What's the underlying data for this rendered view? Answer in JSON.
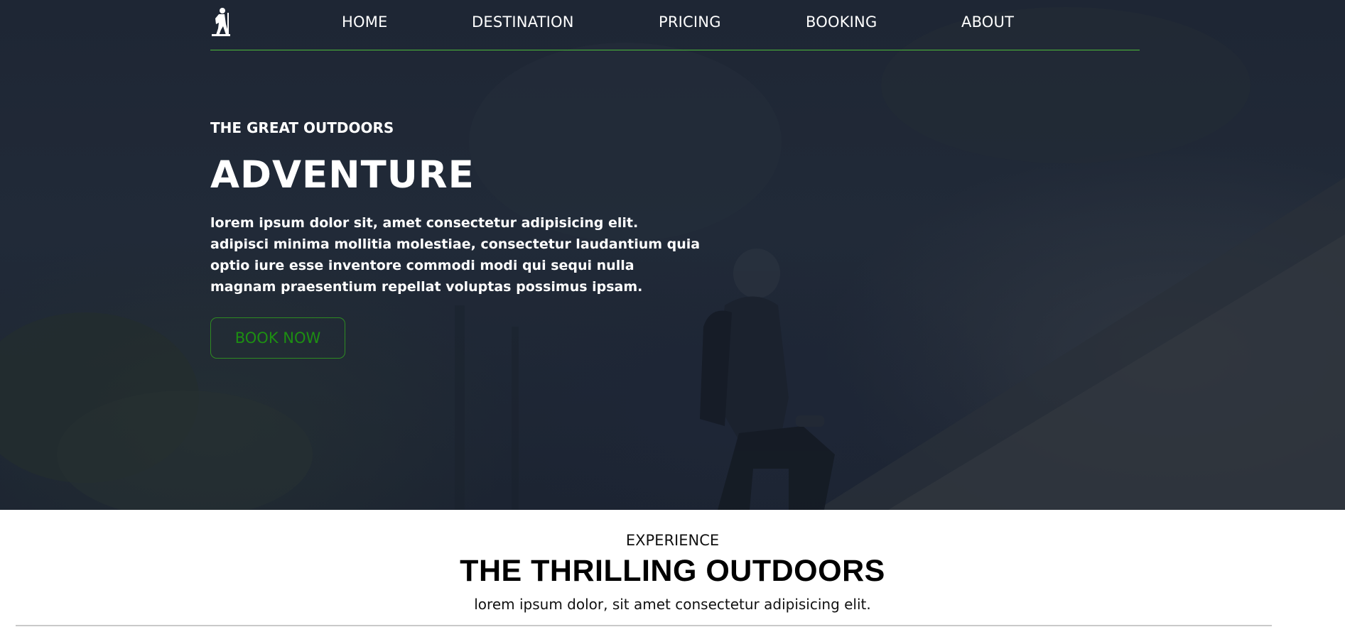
{
  "colors": {
    "accent": "#4cbb3a",
    "button_text": "#1d8f12",
    "hero_overlay": "#1e2634"
  },
  "nav": {
    "logo_icon": "hiker-logo-icon",
    "links": [
      {
        "label": "HOME"
      },
      {
        "label": "DESTINATION"
      },
      {
        "label": "PRICING"
      },
      {
        "label": "BOOKING"
      },
      {
        "label": "ABOUT"
      }
    ]
  },
  "hero": {
    "eyebrow": "THE GREAT OUTDOORS",
    "title": "ADVENTURE",
    "text": "lorem ipsum dolor sit, amet consectetur adipisicing elit. adipisci minima mollitia molestiae, consectetur laudantium quia optio iure esse inventore commodi modi qui sequi nulla magnam praesentium repellat voluptas possimus ipsam.",
    "button_label": "BOOK NOW"
  },
  "experience": {
    "eyebrow": "EXPERIENCE",
    "title": "THE THRILLING OUTDOORS",
    "text": "lorem ipsum dolor, sit amet consectetur adipisicing elit."
  }
}
